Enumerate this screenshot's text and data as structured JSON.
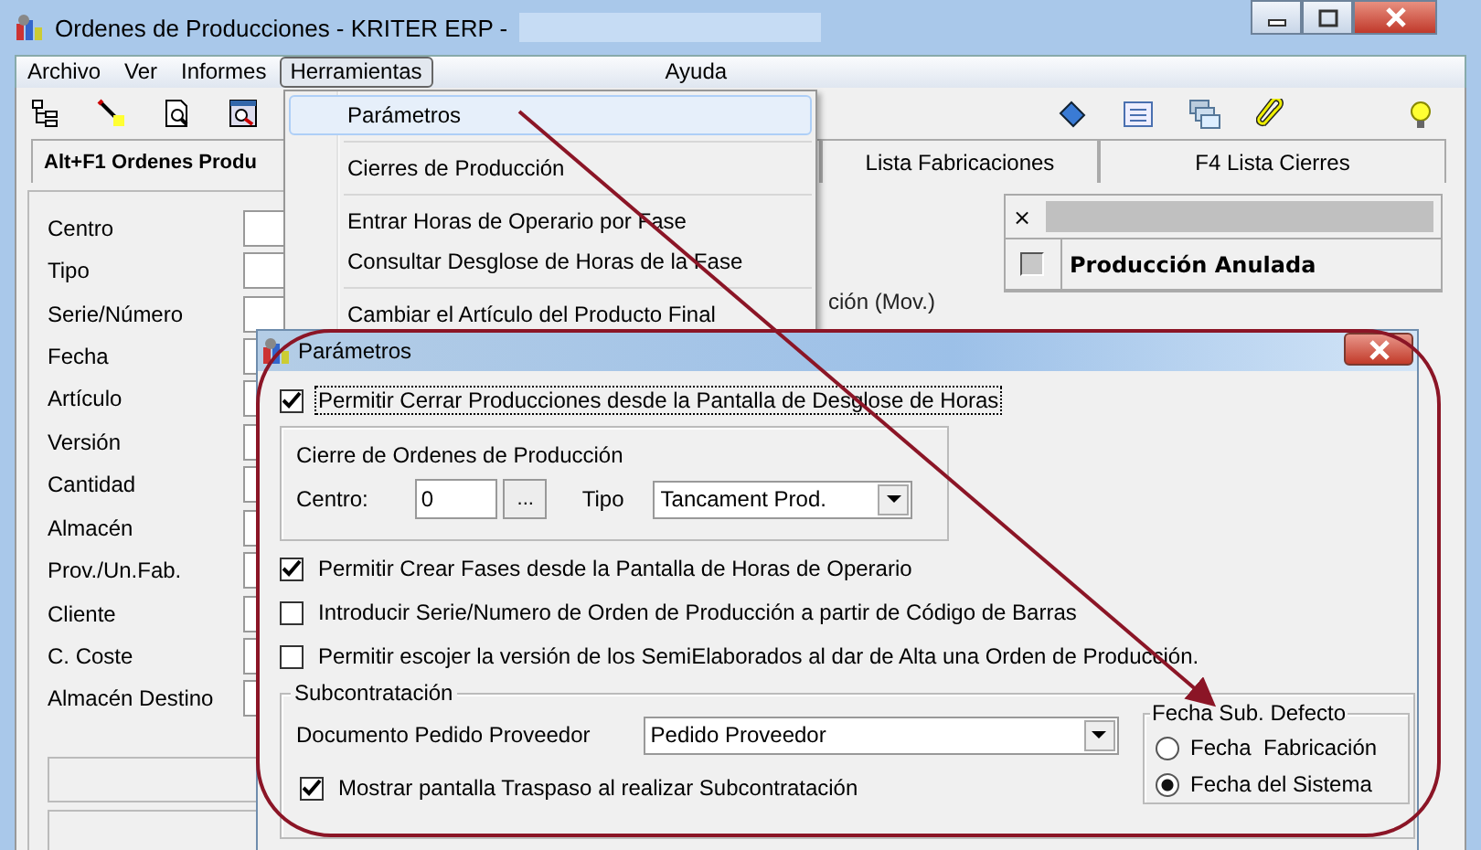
{
  "window": {
    "title": "Ordenes de Producciones - KRITER ERP -"
  },
  "menu_bar": [
    {
      "label": "Archivo",
      "selected": false
    },
    {
      "label": "Ver",
      "selected": false
    },
    {
      "label": "Informes",
      "selected": false
    },
    {
      "label": "Herramientas",
      "selected": true
    },
    {
      "label": "Ayuda",
      "selected": false
    }
  ],
  "tabs": [
    {
      "label": "Alt+F1 Ordenes Produ",
      "selected": true
    },
    {
      "label": "Lista Fabricaciones",
      "selected": false
    },
    {
      "label": "F4 Lista Cierres",
      "selected": false
    }
  ],
  "form": {
    "labels": [
      "Centro",
      "Tipo",
      "Serie/Número",
      "Fecha",
      "Artículo",
      "Versión",
      "Cantidad",
      "Almacén",
      "Prov./Un.Fab.",
      "Cliente",
      "C. Coste",
      "Almacén Destino"
    ]
  },
  "right_panel": {
    "close": "×",
    "rows": [
      {
        "label": "Producción Anulada",
        "checked": false
      }
    ],
    "fragment": "ción (Mov.)"
  },
  "menu": {
    "items": [
      {
        "kind": "item",
        "label": "Parámetros",
        "selected": true
      },
      {
        "kind": "separator"
      },
      {
        "kind": "item",
        "label": "Cierres de Producción",
        "selected": false
      },
      {
        "kind": "separator"
      },
      {
        "kind": "item",
        "label": "Entrar Horas de Operario por Fase",
        "selected": false
      },
      {
        "kind": "item",
        "label": "Consultar Desglose de Horas de la Fase",
        "selected": false
      },
      {
        "kind": "separator"
      },
      {
        "kind": "item",
        "label": "Cambiar el Artículo del Producto Final",
        "selected": false
      }
    ]
  },
  "dialog": {
    "title": "Parámetros",
    "top_option": {
      "label": "Permitir Cerrar Producciones desde la Pantalla de Desglose de Horas",
      "checked": true,
      "focused": true
    },
    "cierre_group": {
      "title": "Cierre de Ordenes de Producción",
      "centro_label": "Centro:",
      "centro_value": "0",
      "browse_button": "...",
      "tipo_label": "Tipo",
      "tipo_value": "Tancament Prod."
    },
    "options": [
      {
        "label": "Permitir Crear Fases desde la Pantalla de Horas de Operario",
        "checked": true
      },
      {
        "label": "Introducir Serie/Numero de Orden de Producción a partir de Código de Barras",
        "checked": false
      },
      {
        "label": "Permitir escojer la versión de los SemiElaborados al dar de Alta una Orden de Producción.",
        "checked": false
      }
    ],
    "subcontratacion": {
      "title": "Subcontratación",
      "documento_label": "Documento Pedido Proveedor",
      "documento_value": "Pedido Proveedor",
      "mostrar": {
        "label": "Mostrar pantalla Traspaso al realizar Subcontratación",
        "checked": true
      },
      "fecha_group": {
        "title": "Fecha Sub. Defecto",
        "options": [
          {
            "label": "Fecha  Fabricación",
            "selected": false
          },
          {
            "label": "Fecha del Sistema",
            "selected": true
          }
        ]
      }
    }
  }
}
